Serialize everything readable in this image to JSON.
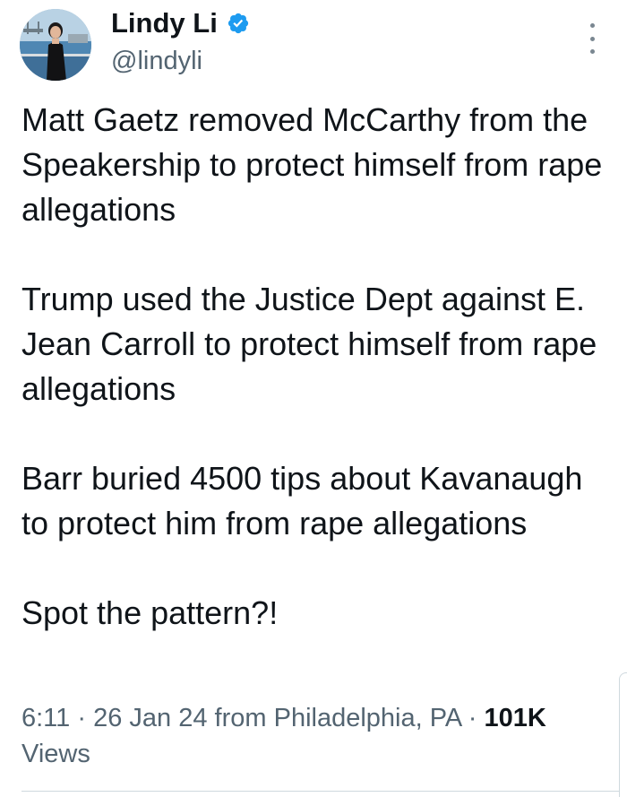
{
  "author": {
    "name": "Lindy Li",
    "handle": "@lindyli",
    "verified_icon": "verified-badge-icon",
    "verified_color": "#1d9bf0"
  },
  "tweet": {
    "paragraphs": [
      "Matt Gaetz removed McCarthy from the Speakership to protect himself from rape allegations",
      "Trump used the Justice Dept against E. Jean Carroll to protect himself from rape allegations",
      "Barr buried 4500 tips about Kavanaugh to protect him from rape allegations",
      "Spot the pattern?!"
    ]
  },
  "meta": {
    "time": "6:11",
    "separator": "·",
    "date": "26 Jan 24",
    "location": "from Philadelphia, PA",
    "views_count": "101K",
    "views_label": "Views"
  },
  "menu": {
    "icon": "more-options-icon"
  },
  "colors": {
    "text_primary": "#0f1419",
    "text_secondary": "#536471",
    "divider": "#cfd9de"
  }
}
